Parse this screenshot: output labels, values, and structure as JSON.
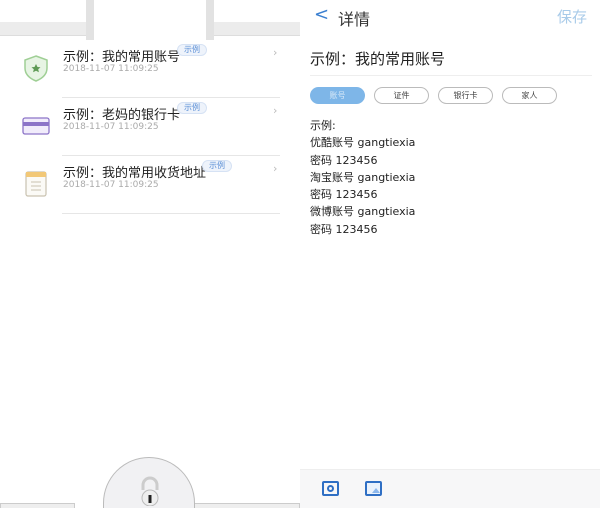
{
  "list": {
    "items": [
      {
        "title": "示例：我的常用账号",
        "badge": "示例",
        "date": "2018-11-07 11:09:25",
        "icon": "shield-icon"
      },
      {
        "title": "示例：老妈的银行卡",
        "badge": "示例",
        "date": "2018-11-07 11:09:25",
        "icon": "bank-card-icon"
      },
      {
        "title": "示例：我的常用收货地址",
        "badge": "示例",
        "date": "2018-11-07 11:09:25",
        "icon": "notepad-icon"
      }
    ]
  },
  "detail": {
    "header_title": "详情",
    "save_label": "保存",
    "title": "示例：我的常用账号",
    "tags": [
      "账号",
      "证件",
      "银行卡",
      "家人"
    ],
    "lines": [
      "示例:",
      "优酷账号 gangtiexia",
      "密码 123456",
      "淘宝账号 gangtiexia",
      "密码 123456",
      "微博账号 gangtiexia",
      "密码 123456"
    ]
  },
  "colors": {
    "accent": "#3a7fd0",
    "active_tag": "#7eb6e8"
  }
}
